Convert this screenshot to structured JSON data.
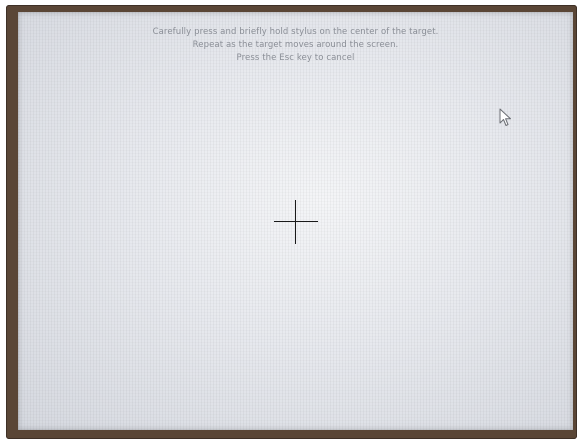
{
  "calibration": {
    "instructions": {
      "line1": "Carefully press and briefly hold stylus on the center of the target.",
      "line2": "Repeat as the target moves around the screen.",
      "line3": "Press the Esc key to cancel"
    },
    "target_icon": "crosshair-icon",
    "cursor_icon": "mouse-pointer-icon"
  }
}
